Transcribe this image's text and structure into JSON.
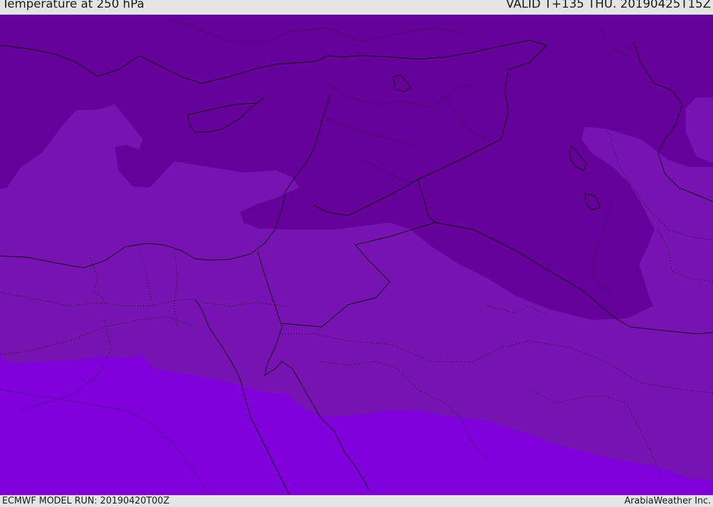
{
  "header": {
    "title": "Temperature at 250 hPa",
    "valid": "VALID T+135 THU. 20190425T15Z"
  },
  "footer": {
    "model_run": "ECMWF MODEL RUN: 20190420T00Z",
    "credit": "ArabiaWeather Inc."
  },
  "colors": {
    "coldest_band": "#66009a",
    "mid_band": "#7713b2",
    "warm_band": "#7f00db",
    "border_line": "#111111",
    "bar_background": "#e4e4e4"
  }
}
